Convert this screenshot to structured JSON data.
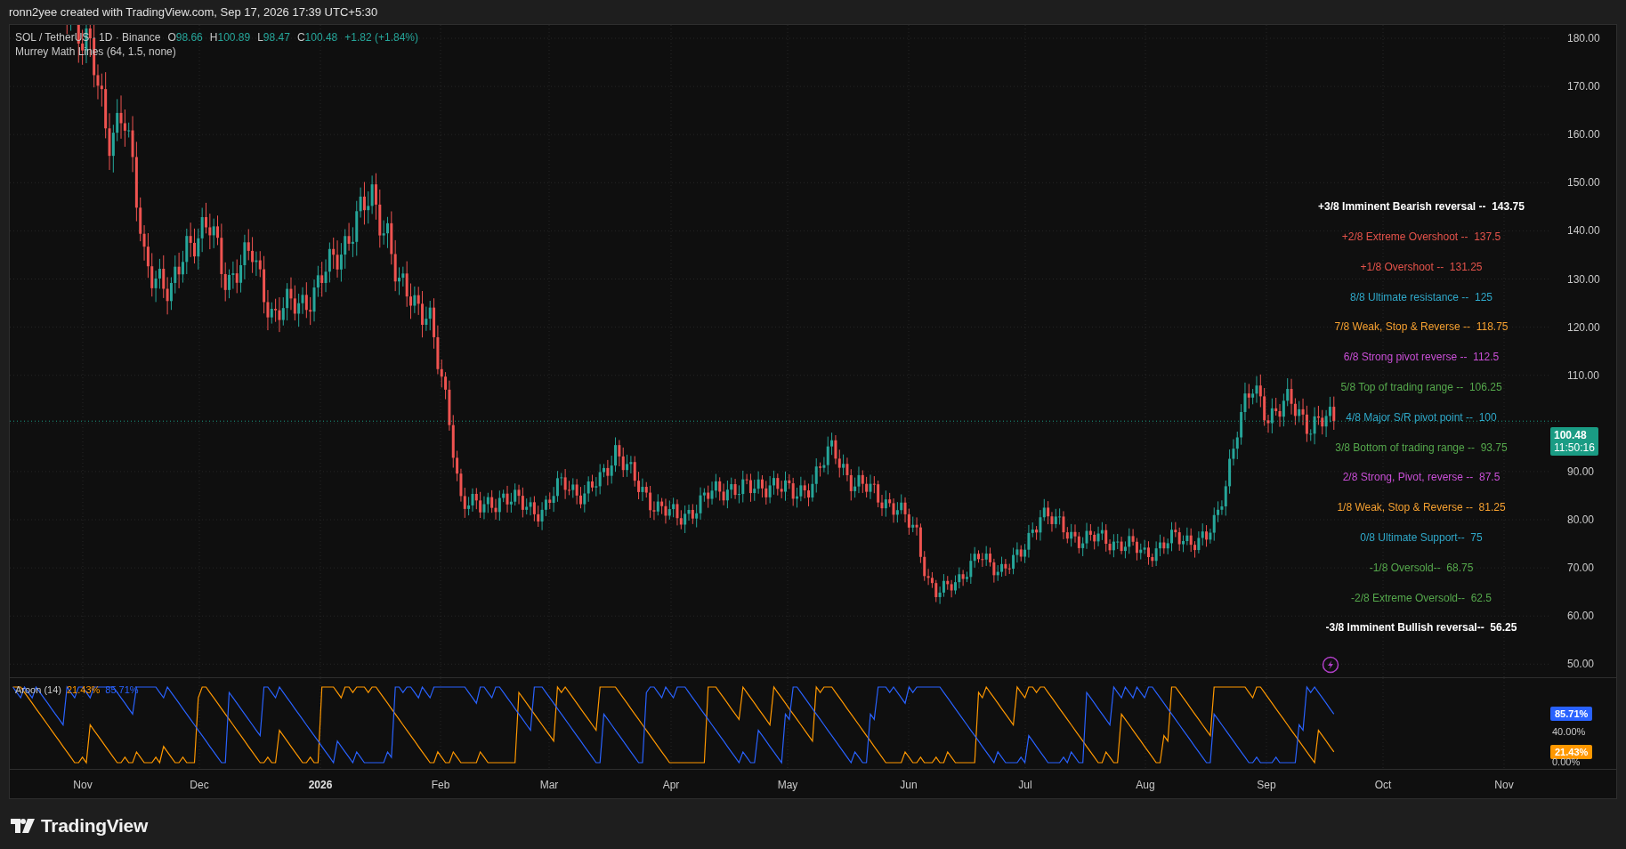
{
  "header": {
    "text": "ronn2yee created with TradingView.com, Sep 17, 2026 17:39 UTC+5:30"
  },
  "main_pane": {
    "legend": {
      "symbol": "SOL / TetherUS · 1D · Binance",
      "ohlc": [
        {
          "label": "O",
          "value": "98.66"
        },
        {
          "label": "H",
          "value": "100.89"
        },
        {
          "label": "L",
          "value": "98.47"
        },
        {
          "label": "C",
          "value": "100.48"
        }
      ],
      "change": "+1.82 (+1.84%)"
    },
    "indicator": "Murrey Math Lines (64, 1.5, none)",
    "price_axis": [
      "180.00",
      "170.00",
      "160.00",
      "150.00",
      "140.00",
      "130.00",
      "120.00",
      "110.00",
      "90.00",
      "80.00",
      "70.00",
      "60.00",
      "50.00"
    ],
    "last_price": {
      "price": "100.48",
      "countdown": "11:50:16"
    },
    "murrey_levels": [
      {
        "text": "+3/8 Imminent Bearish reversal --  143.75",
        "kind": "extreme",
        "color": "#ffffff"
      },
      {
        "text": "+2/8 Extreme Overshoot --  137.5",
        "kind": "level",
        "color": "#e5534b"
      },
      {
        "text": "+1/8 Overshoot --  131.25",
        "kind": "level",
        "color": "#e5534b"
      },
      {
        "text": "8/8 Ultimate resistance --  125",
        "kind": "level",
        "color": "#2fa8c9"
      },
      {
        "text": "7/8 Weak, Stop & Reverse --  118.75",
        "kind": "level",
        "color": "#f5a030"
      },
      {
        "text": "6/8 Strong pivot reverse --  112.5",
        "kind": "level",
        "color": "#c94fd6"
      },
      {
        "text": "5/8 Top of trading range --  106.25",
        "kind": "level",
        "color": "#55a84c"
      },
      {
        "text": "4/8 Major S/R pivot point --  100",
        "kind": "level",
        "color": "#2fa8c9"
      },
      {
        "text": "3/8 Bottom of trading range --  93.75",
        "kind": "level",
        "color": "#55a84c"
      },
      {
        "text": "2/8 Strong, Pivot, reverse --  87.5",
        "kind": "level",
        "color": "#c94fd6"
      },
      {
        "text": "1/8 Weak, Stop & Reverse --  81.25",
        "kind": "level",
        "color": "#f5a030"
      },
      {
        "text": "0/8 Ultimate Support--  75",
        "kind": "level",
        "color": "#2fa8c9"
      },
      {
        "text": "-1/8 Oversold--  68.75",
        "kind": "level",
        "color": "#55a84c"
      },
      {
        "text": "-2/8 Extreme Oversold--  62.5",
        "kind": "level",
        "color": "#55a84c"
      },
      {
        "text": "-3/8 Imminent Bullish reversal--  56.25",
        "kind": "extreme",
        "color": "#ffffff"
      }
    ]
  },
  "aroon_pane": {
    "title": "Aroon (14)",
    "series": [
      {
        "kind": "up",
        "value": "21.43%",
        "color": "#ff9800"
      },
      {
        "kind": "down",
        "value": "85.71%",
        "color": "#2962ff"
      }
    ],
    "badges": [
      {
        "kind": "down",
        "text": "85.71%",
        "color": "#2962ff"
      },
      {
        "kind": "up",
        "text": "21.43%",
        "color": "#ff9800"
      }
    ],
    "axis": [
      "40.00%",
      "0.00%"
    ]
  },
  "time_axis": [
    {
      "label": "Nov",
      "kind": "month"
    },
    {
      "label": "Dec",
      "kind": "month"
    },
    {
      "label": "2026",
      "kind": "year"
    },
    {
      "label": "Feb",
      "kind": "month"
    },
    {
      "label": "Mar",
      "kind": "month"
    },
    {
      "label": "Apr",
      "kind": "month"
    },
    {
      "label": "May",
      "kind": "month"
    },
    {
      "label": "Jun",
      "kind": "month"
    },
    {
      "label": "Jul",
      "kind": "month"
    },
    {
      "label": "Aug",
      "kind": "month"
    },
    {
      "label": "Sep",
      "kind": "month"
    },
    {
      "label": "Oct",
      "kind": "month"
    },
    {
      "label": "Nov",
      "kind": "month"
    }
  ],
  "footer": {
    "logo": "TradingView"
  }
}
